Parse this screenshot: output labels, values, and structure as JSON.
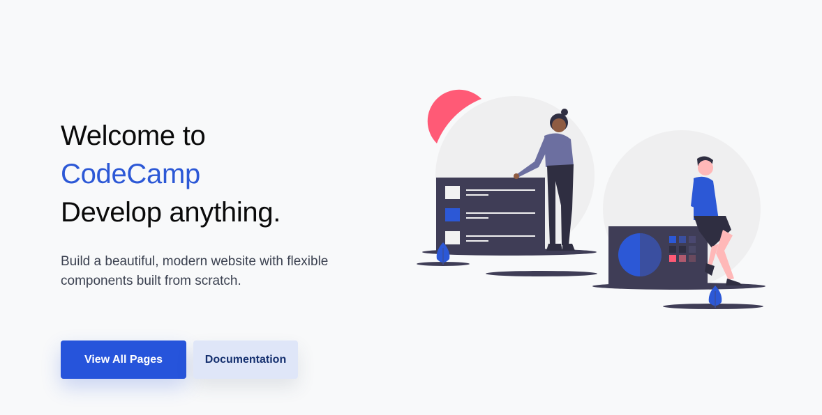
{
  "hero": {
    "headline_line1": "Welcome to",
    "headline_brand": "CodeCamp",
    "headline_line3": "Develop anything.",
    "lead": "Build a beautiful, modern website with flexible components built from scratch."
  },
  "buttons": {
    "primary_label": "View All Pages",
    "secondary_label": "Documentation"
  },
  "illustration": {
    "icons": [
      "person-standing-icon",
      "person-sitting-icon",
      "board-with-checklist-icon",
      "board-with-pie-chart-icon",
      "leaf-icon"
    ]
  },
  "colors": {
    "brand": "#2c58d6",
    "primary_button": "#2654db",
    "secondary_button": "#dfe6f8",
    "accent_pink": "#ff5a76",
    "dark_board": "#3f3d56",
    "background": "#f8f9fa"
  }
}
